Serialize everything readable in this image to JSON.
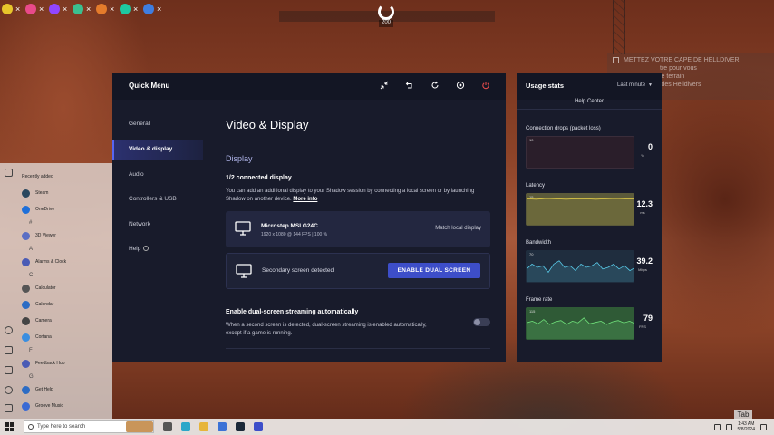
{
  "top_apps": [
    {
      "icon": "yellow-app-icon",
      "color": "#e7c52b",
      "letter": ""
    },
    {
      "icon": "pink-app-icon",
      "color": "#e94a8a",
      "letter": ""
    },
    {
      "icon": "purple-app-icon",
      "color": "#9146ff",
      "letter": ""
    },
    {
      "icon": "green-app-icon",
      "color": "#3bbf8f",
      "letter": ""
    },
    {
      "icon": "orange-app-icon",
      "color": "#e57b2b",
      "letter": ""
    },
    {
      "icon": "teal-app-icon",
      "color": "#1ec7a0",
      "letter": ""
    },
    {
      "icon": "blue-app-icon",
      "color": "#3f7de0",
      "letter": ""
    }
  ],
  "close_glyph": "×",
  "game": {
    "hud_number": "200",
    "objective_line1": "METTEZ VOTRE CAPE DE HELLDIVER",
    "objective_line2": "tre pour vous",
    "objective_line3": "le terrain",
    "objective_line4": "ment des Helldivers",
    "tab_key": "Tab"
  },
  "start_menu": {
    "rows": [
      {
        "type": "header",
        "label": "Recently added"
      },
      {
        "type": "app",
        "label": "Steam",
        "color": "#2a475e"
      },
      {
        "type": "app",
        "label": "OneDrive",
        "color": "#1e6fd9"
      },
      {
        "type": "letter",
        "label": "#"
      },
      {
        "type": "app",
        "label": "3D Viewer",
        "color": "#5a6ec4"
      },
      {
        "type": "letter",
        "label": "A"
      },
      {
        "type": "app",
        "label": "Alarms & Clock",
        "color": "#4a5bb5"
      },
      {
        "type": "letter",
        "label": "C"
      },
      {
        "type": "app",
        "label": "Calculator",
        "color": "#555"
      },
      {
        "type": "app",
        "label": "Calendar",
        "color": "#2c6cc4"
      },
      {
        "type": "app",
        "label": "Camera",
        "color": "#444"
      },
      {
        "type": "app",
        "label": "Cortana",
        "color": "#3a8ee0"
      },
      {
        "type": "letter",
        "label": "F"
      },
      {
        "type": "app",
        "label": "Feedback Hub",
        "color": "#4a5bb5"
      },
      {
        "type": "letter",
        "label": "G"
      },
      {
        "type": "app",
        "label": "Get Help",
        "color": "#2c6cc4"
      },
      {
        "type": "app",
        "label": "Groove Music",
        "color": "#3a6ad4"
      }
    ]
  },
  "taskbar": {
    "search_placeholder": "Type here to search",
    "icons": [
      {
        "name": "task-view-icon",
        "color": "#555"
      },
      {
        "name": "edge-icon",
        "color": "#2aa7c9"
      },
      {
        "name": "explorer-icon",
        "color": "#e7b53a"
      },
      {
        "name": "store-icon",
        "color": "#3c72d6"
      },
      {
        "name": "steam-icon",
        "color": "#1b2838"
      },
      {
        "name": "shadow-icon",
        "color": "#3d4ec9"
      }
    ],
    "time": "1:43 AM",
    "date": "5/8/2024"
  },
  "quick_menu": {
    "title": "Quick Menu",
    "nav": [
      {
        "label": "General",
        "active": false
      },
      {
        "label": "Video & display",
        "active": true
      },
      {
        "label": "Audio",
        "active": false
      },
      {
        "label": "Controllers & USB",
        "active": false
      },
      {
        "label": "Network",
        "active": false
      },
      {
        "label": "Help",
        "active": false
      }
    ],
    "content": {
      "title": "Video & Display",
      "section": "Display",
      "connected_count": "1/2 connected display",
      "description": "You can add an additional display to your Shadow session by connecting a local screen or by launching Shadow on another device.",
      "more_info": "More info",
      "primary_display": {
        "name": "Microstep MSI G24C",
        "spec": "1920 x 1080 @ 144 FPS  |  100 %",
        "action": "Match local display"
      },
      "secondary_display": {
        "label": "Secondary screen detected",
        "action": "ENABLE DUAL SCREEN"
      },
      "auto_title": "Enable dual-screen streaming automatically",
      "auto_description": "When a second screen is detected, dual-screen streaming is enabled automatically, except if a game is running.",
      "auto_enabled": false
    }
  },
  "usage_stats": {
    "title": "Usage stats",
    "period": "Last minute",
    "help_center": "Help Center",
    "stats": [
      {
        "label": "Connection drops (packet loss)",
        "axis": "10",
        "value": "0",
        "unit": "%",
        "color": "#2a1e2a",
        "line": "#c84a4a"
      },
      {
        "label": "Latency",
        "axis": "15",
        "value": "12.3",
        "unit": "ms",
        "color": "#5b5a3a",
        "line": "#e7d04a"
      },
      {
        "label": "Bandwidth",
        "axis": "70",
        "value": "39.2",
        "unit": "Mbps",
        "color": "#1f2d3e",
        "line": "#58c8e6"
      },
      {
        "label": "Frame rate",
        "axis": "115",
        "value": "79",
        "unit": "FPS",
        "color": "#2f5a36",
        "line": "#6fe07a"
      }
    ]
  }
}
